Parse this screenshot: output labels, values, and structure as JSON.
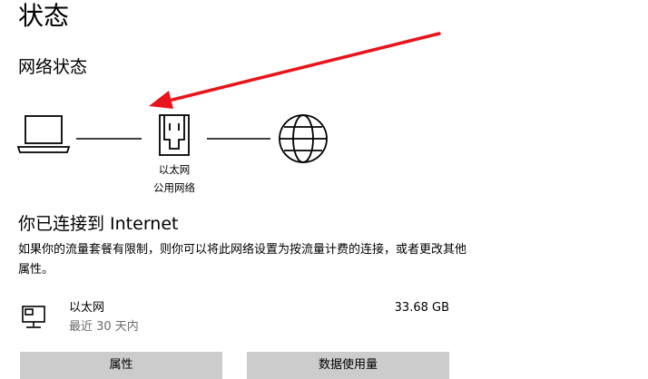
{
  "header": {
    "title": "状态"
  },
  "network_status": {
    "title": "网络状态",
    "adapter_label": "以太网",
    "profile_label": "公用网络"
  },
  "connection": {
    "heading": "你已连接到 Internet",
    "description": "如果你的流量套餐有限制，则你可以将此网络设置为按流量计费的连接，或者更改其他属性。"
  },
  "adapter": {
    "name": "以太网",
    "period": "最近 30 天内",
    "usage": "33.68 GB"
  },
  "buttons": {
    "properties": "属性",
    "data_usage": "数据使用量"
  },
  "annotation": {
    "arrow_color": "#e8141b"
  },
  "icons": [
    "laptop-icon",
    "ethernet-icon",
    "globe-icon",
    "network-adapter-icon"
  ]
}
